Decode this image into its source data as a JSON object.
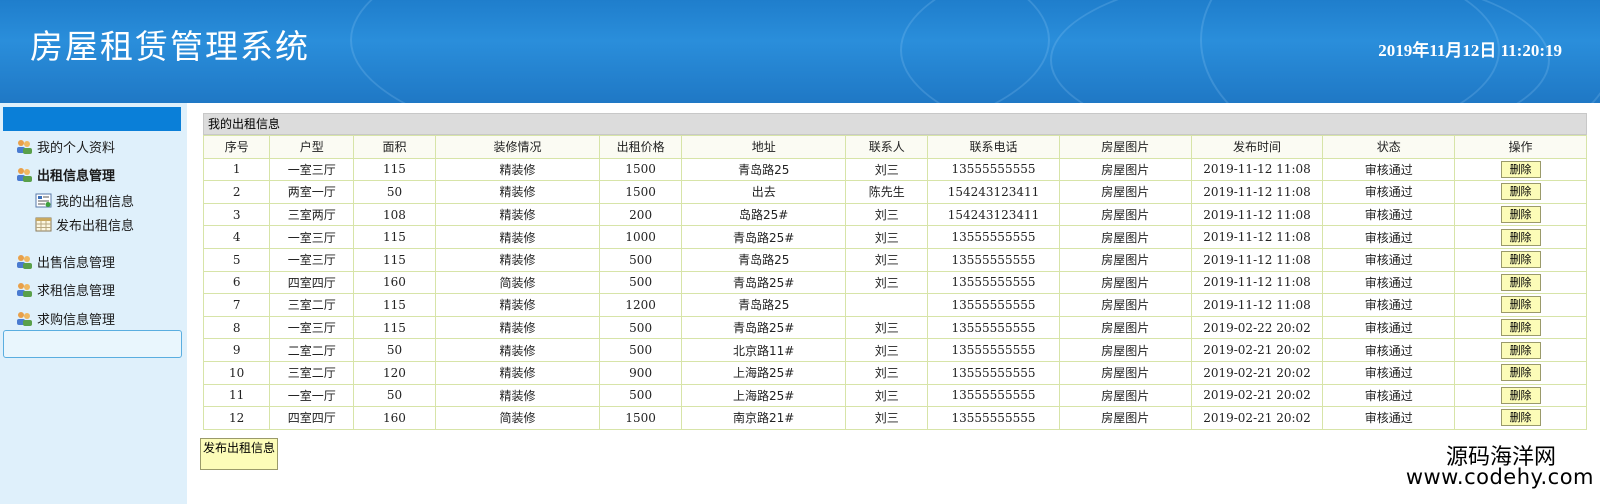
{
  "header": {
    "title": "房屋租赁管理系统",
    "datetime": "2019年11月12日 11:20:19",
    "brand_color": "#1f7ecc"
  },
  "sidebar": {
    "items": [
      {
        "label": "我的个人资料",
        "icon": "users-icon"
      },
      {
        "label": "出租信息管理",
        "icon": "users-icon"
      },
      {
        "label": "我的出租信息",
        "icon": "list-icon"
      },
      {
        "label": "发布出租信息",
        "icon": "calendar-icon"
      },
      {
        "label": "出售信息管理",
        "icon": "users-icon"
      },
      {
        "label": "求租信息管理",
        "icon": "users-icon"
      },
      {
        "label": "求购信息管理",
        "icon": "users-icon"
      }
    ]
  },
  "main": {
    "panel_title": "我的出租信息",
    "columns": [
      "序号",
      "户型",
      "面积",
      "装修情况",
      "出租价格",
      "地址",
      "联系人",
      "联系电话",
      "房屋图片",
      "发布时间",
      "状态",
      "操作"
    ],
    "rows": [
      {
        "no": "1",
        "type": "一室三厅",
        "area": "115",
        "decor": "精装修",
        "price": "1500",
        "addr": "青岛路25",
        "contact": "刘三",
        "phone": "13555555555",
        "img": "房屋图片",
        "time": "2019-11-12 11:08",
        "status": "审核通过",
        "op": "删除"
      },
      {
        "no": "2",
        "type": "两室一厅",
        "area": "50",
        "decor": "精装修",
        "price": "1500",
        "addr": "出去",
        "contact": "陈先生",
        "phone": "154243123411",
        "img": "房屋图片",
        "time": "2019-11-12 11:08",
        "status": "审核通过",
        "op": "删除"
      },
      {
        "no": "3",
        "type": "三室两厅",
        "area": "108",
        "decor": "精装修",
        "price": "200",
        "addr": "岛路25#",
        "contact": "刘三",
        "phone": "154243123411",
        "img": "房屋图片",
        "time": "2019-11-12 11:08",
        "status": "审核通过",
        "op": "删除"
      },
      {
        "no": "4",
        "type": "一室三厅",
        "area": "115",
        "decor": "精装修",
        "price": "1000",
        "addr": "青岛路25#",
        "contact": "刘三",
        "phone": "13555555555",
        "img": "房屋图片",
        "time": "2019-11-12 11:08",
        "status": "审核通过",
        "op": "删除"
      },
      {
        "no": "5",
        "type": "一室三厅",
        "area": "115",
        "decor": "精装修",
        "price": "500",
        "addr": "青岛路25",
        "contact": "刘三",
        "phone": "13555555555",
        "img": "房屋图片",
        "time": "2019-11-12 11:08",
        "status": "审核通过",
        "op": "删除"
      },
      {
        "no": "6",
        "type": "四室四厅",
        "area": "160",
        "decor": "简装修",
        "price": "500",
        "addr": "青岛路25#",
        "contact": "刘三",
        "phone": "13555555555",
        "img": "房屋图片",
        "time": "2019-11-12 11:08",
        "status": "审核通过",
        "op": "删除"
      },
      {
        "no": "7",
        "type": "三室二厅",
        "area": "115",
        "decor": "精装修",
        "price": "1200",
        "addr": "青岛路25",
        "contact": "",
        "phone": "13555555555",
        "img": "房屋图片",
        "time": "2019-11-12 11:08",
        "status": "审核通过",
        "op": "删除"
      },
      {
        "no": "8",
        "type": "一室三厅",
        "area": "115",
        "decor": "精装修",
        "price": "500",
        "addr": "青岛路25#",
        "contact": "刘三",
        "phone": "13555555555",
        "img": "房屋图片",
        "time": "2019-02-22 20:02",
        "status": "审核通过",
        "op": "删除"
      },
      {
        "no": "9",
        "type": "二室二厅",
        "area": "50",
        "decor": "精装修",
        "price": "500",
        "addr": "北京路11#",
        "contact": "刘三",
        "phone": "13555555555",
        "img": "房屋图片",
        "time": "2019-02-21 20:02",
        "status": "审核通过",
        "op": "删除"
      },
      {
        "no": "10",
        "type": "三室二厅",
        "area": "120",
        "decor": "精装修",
        "price": "900",
        "addr": "上海路25#",
        "contact": "刘三",
        "phone": "13555555555",
        "img": "房屋图片",
        "time": "2019-02-21 20:02",
        "status": "审核通过",
        "op": "删除"
      },
      {
        "no": "11",
        "type": "一室一厅",
        "area": "50",
        "decor": "精装修",
        "price": "500",
        "addr": "上海路25#",
        "contact": "刘三",
        "phone": "13555555555",
        "img": "房屋图片",
        "time": "2019-02-21 20:02",
        "status": "审核通过",
        "op": "删除"
      },
      {
        "no": "12",
        "type": "四室四厅",
        "area": "160",
        "decor": "简装修",
        "price": "1500",
        "addr": "南京路21#",
        "contact": "刘三",
        "phone": "13555555555",
        "img": "房屋图片",
        "time": "2019-02-21 20:02",
        "status": "审核通过",
        "op": "删除"
      }
    ],
    "publish_button": "发布出租信息"
  },
  "watermark": {
    "cn": "源码海洋网",
    "url": "www.codehy.com"
  }
}
